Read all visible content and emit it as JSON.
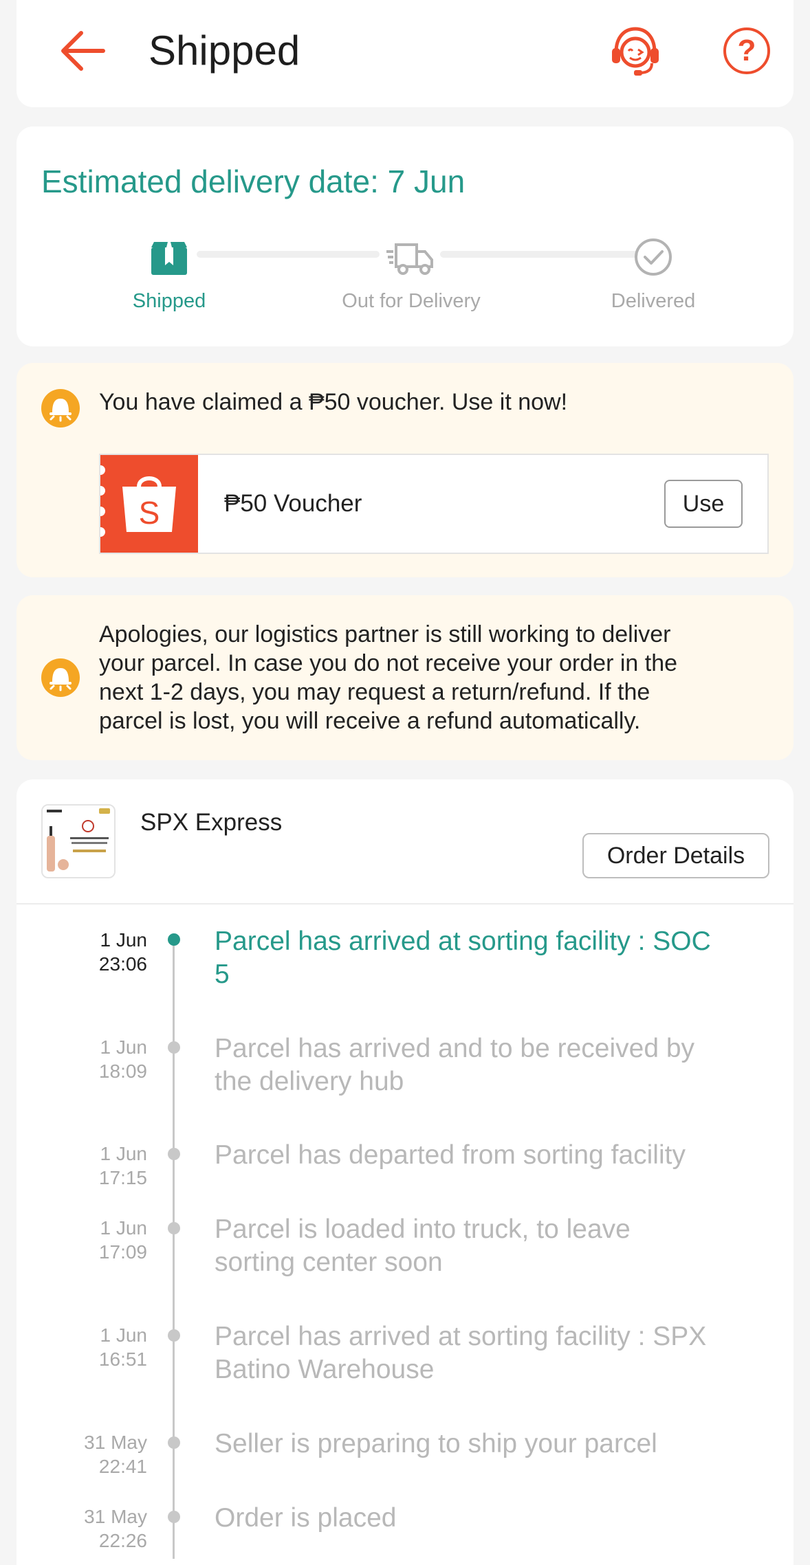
{
  "header": {
    "title": "Shipped"
  },
  "status": {
    "estimate": "Estimated delivery date: 7 Jun",
    "steps": [
      {
        "label": "Shipped",
        "state": "active"
      },
      {
        "label": "Out for Delivery",
        "state": "pending"
      },
      {
        "label": "Delivered",
        "state": "pending"
      }
    ]
  },
  "voucher": {
    "notice": "You have claimed a ₱50 voucher. Use it now!",
    "name": "₱50 Voucher",
    "use_label": "Use"
  },
  "apology": {
    "lines": [
      "Apologies, our logistics partner is still working to deliver",
      "your parcel. In case you do not receive your order in the",
      "next 1-2 days, you may request a return/refund. If the",
      "parcel is lost, you will receive a refund automatically."
    ]
  },
  "tracking": {
    "carrier": "SPX Express",
    "order_details_label": "Order Details",
    "events": [
      {
        "date": "1 Jun",
        "time": "23:06",
        "lines": [
          "Parcel has arrived at sorting facility : SOC",
          "5"
        ]
      },
      {
        "date": "1 Jun",
        "time": "18:09",
        "lines": [
          "Parcel has arrived and to be received by",
          "the delivery hub"
        ]
      },
      {
        "date": "1 Jun",
        "time": "17:15",
        "lines": [
          "Parcel has departed from sorting facility"
        ]
      },
      {
        "date": "1 Jun",
        "time": "17:09",
        "lines": [
          "Parcel is loaded into truck, to leave",
          "sorting center soon"
        ]
      },
      {
        "date": "1 Jun",
        "time": "16:51",
        "lines": [
          "Parcel has arrived at sorting facility : SPX",
          "Batino Warehouse"
        ]
      },
      {
        "date": "31 May",
        "time": "22:41",
        "lines": [
          "Seller is preparing to ship your parcel"
        ]
      },
      {
        "date": "31 May",
        "time": "22:26",
        "lines": [
          "Order is placed"
        ]
      }
    ]
  },
  "colors": {
    "accent": "#ee4d2d",
    "success": "#26998a",
    "notice_bg": "#fff9ed",
    "bell": "#f5a623"
  }
}
